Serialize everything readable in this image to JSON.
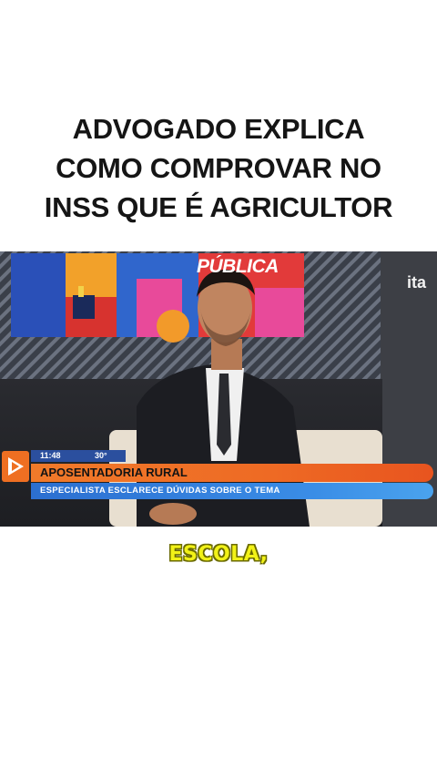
{
  "headline": {
    "lines": [
      "ADVOGADO EXPLICA",
      "COMO COMPROVAR NO",
      "INSS QUE É AGRICULTOR"
    ]
  },
  "video": {
    "channel_logo": "ita",
    "backdrop_text": "PÚBLICA",
    "ticker": {
      "time": "11:48",
      "temperature": "30°",
      "headline": "APOSENTADORIA RURAL",
      "subheadline": "ESPECIALISTA ESCLARECE DÚVIDAS SOBRE O TEMA",
      "icon": "play-icon"
    }
  },
  "caption": "ESCOLA,",
  "colors": {
    "caption_fill": "#f2f217",
    "ticker_orange": "#ee6a24",
    "ticker_blue": "#3a8de6",
    "time_bar": "#2b4f9e"
  }
}
